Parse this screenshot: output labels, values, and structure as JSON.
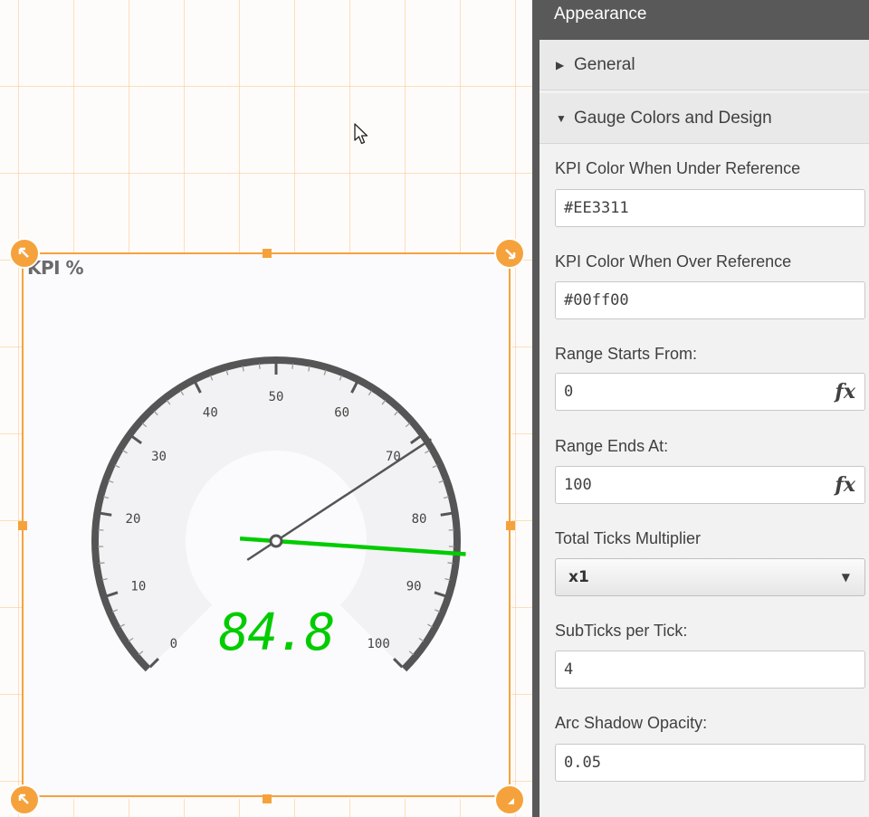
{
  "object": {
    "title": "KPI %"
  },
  "gauge": {
    "value": 84.8,
    "value_display": "84.8",
    "range_start": 0,
    "range_end": 100,
    "reference_value": 71,
    "tick_labels": [
      "0",
      "10",
      "20",
      "30",
      "40",
      "50",
      "60",
      "70",
      "80",
      "90",
      "100"
    ],
    "value_color": "#00cc00",
    "arc_color": "#555555",
    "band_color": "#f2f2f4"
  },
  "panel": {
    "header": "Appearance",
    "sections": {
      "general": "General",
      "gauge_colors": "Gauge Colors and Design"
    },
    "props": {
      "kpi_under_label": "KPI Color When Under Reference",
      "kpi_under_value": "#EE3311",
      "kpi_over_label": "KPI Color When Over Reference",
      "kpi_over_value": "#00ff00",
      "range_start_label": "Range Starts From:",
      "range_start_value": "0",
      "range_end_label": "Range Ends At:",
      "range_end_value": "100",
      "ticks_mult_label": "Total Ticks Multiplier",
      "ticks_mult_value": "x1",
      "subticks_label": "SubTicks per Tick:",
      "subticks_value": "4",
      "arc_shadow_label": "Arc Shadow Opacity:",
      "arc_shadow_value": "0.05"
    },
    "fx_label": "fx"
  },
  "colors": {
    "selection": "#f5a23c",
    "panel_header": "#595959"
  }
}
